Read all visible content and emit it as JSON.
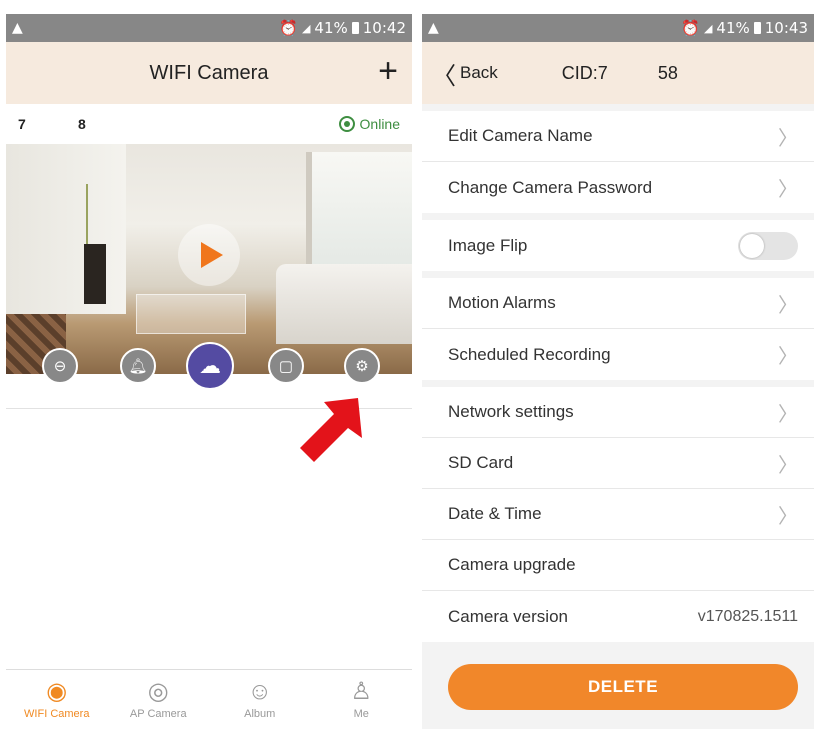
{
  "left": {
    "status": {
      "left_icon": "warning-triangle-icon",
      "battery": "41%",
      "time": "10:42"
    },
    "appbar": {
      "title": "WIFI Camera",
      "add_icon": "plus-icon"
    },
    "camera": {
      "cid_part_1": "7",
      "cid_part_2": "8",
      "status": "Online",
      "actions": [
        "lock-icon",
        "bell-icon",
        "cloud-icon",
        "sd-card-icon",
        "gear-icon"
      ]
    },
    "nav": [
      {
        "label": "WIFI Camera",
        "icon": "webcam-icon",
        "active": true
      },
      {
        "label": "AP Camera",
        "icon": "camera-icon",
        "active": false
      },
      {
        "label": "Album",
        "icon": "album-icon",
        "active": false
      },
      {
        "label": "Me",
        "icon": "person-icon",
        "active": false
      }
    ]
  },
  "right": {
    "status": {
      "left_icon": "warning-triangle-icon",
      "battery": "41%",
      "time": "10:43"
    },
    "appbar": {
      "back_label": "Back",
      "cid_label": "CID:",
      "cid_value_a": "7",
      "cid_value_b": "58"
    },
    "settings": {
      "edit_name": "Edit Camera Name",
      "change_password": "Change Camera Password",
      "image_flip": "Image Flip",
      "image_flip_on": false,
      "motion_alarms": "Motion Alarms",
      "scheduled_recording": "Scheduled Recording",
      "network_settings": "Network settings",
      "sd_card": "SD Card",
      "date_time": "Date & Time",
      "camera_upgrade": "Camera upgrade",
      "camera_version_label": "Camera version",
      "camera_version_value": "v170825.1511"
    },
    "delete_label": "DELETE"
  },
  "colors": {
    "accent": "#f1872a",
    "appbar": "#f6eade",
    "cloud": "#544ba2",
    "online": "#3e8e41",
    "arrow": "#e3131a"
  }
}
